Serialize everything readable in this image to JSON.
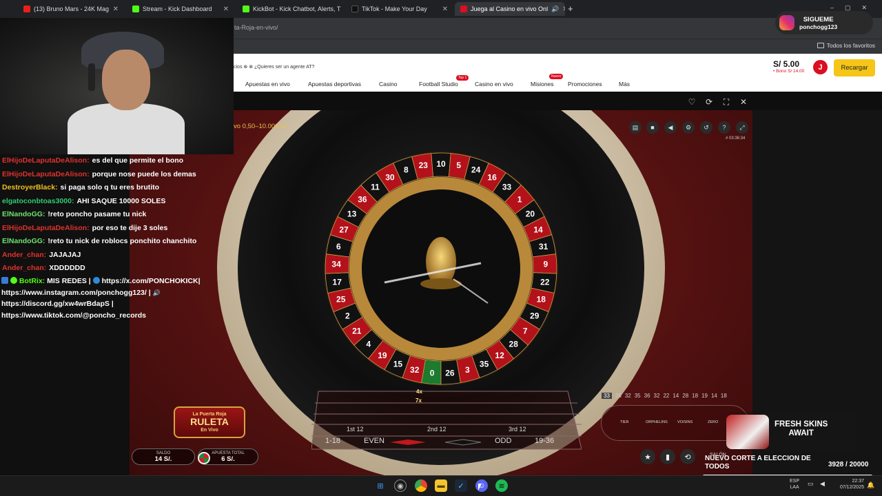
{
  "tabs": [
    {
      "title": "(13) Bruno Mars - 24K Mag",
      "favicon_color": "#e62117"
    },
    {
      "title": "Stream - Kick Dashboard",
      "favicon_color": "#53fc18"
    },
    {
      "title": "KickBot - Kick Chatbot, Alerts, T",
      "favicon_color": "#53fc18"
    },
    {
      "title": "TikTok - Make Your Day",
      "favicon_color": "#111111"
    },
    {
      "title": "Juega al Casino en vivo Onl",
      "favicon_color": "#d90f22"
    }
  ],
  "browser": {
    "url": "ta-Roja-en-vivo/",
    "bookmarks_label": "Todos los favoritos"
  },
  "site": {
    "notice": "cios ⊗ ⊗ ¿Quieres ser un agente AT?",
    "nav": [
      "Apuestas en vivo",
      "Apuestas deportivas",
      "Casino",
      "Football Studio",
      "Casino en vivo",
      "Misiones",
      "Promociones",
      "Más"
    ],
    "badge_top": "Top 1",
    "badge_new": "Nuevo",
    "balance": "S/ 5.00",
    "bonus": "• Bono S/ 14.00",
    "avatar_letter": "J",
    "recharge_label": "Recargar"
  },
  "game": {
    "limits": "vo 0,50–10.000 S/",
    "game_id": "# 03:36:34",
    "logo_line1": "La Puerta Roja",
    "logo_line2": "RULETA",
    "logo_line3": "En Vivo",
    "balance_label": "SALDO",
    "balance_value": "14 S/.",
    "stake_label": "APUESTA TOTAL",
    "stake_value": "6 S/.",
    "history": [
      "33",
      "26",
      "32",
      "35",
      "36",
      "32",
      "22",
      "14",
      "28",
      "18",
      "19",
      "14",
      "18"
    ],
    "racetrack_labels": [
      "TIER",
      "ORPHELINS",
      "VOISINS",
      "ZERO"
    ],
    "outside_bets": [
      "1-18",
      "EVEN",
      "ODD",
      "19-36"
    ],
    "dozens": [
      "1st 12",
      "2nd 12",
      "3rd 12"
    ],
    "multipliers": [
      "4x",
      "7x"
    ],
    "salon_label": "SALÓN",
    "wheel_numbers": [
      "0",
      "32",
      "15",
      "19",
      "4",
      "21",
      "2",
      "25",
      "17",
      "34",
      "6",
      "27",
      "13",
      "36",
      "11",
      "30",
      "8",
      "23",
      "10",
      "5",
      "24",
      "16",
      "33",
      "1",
      "20",
      "14",
      "31",
      "9",
      "22",
      "18",
      "29",
      "7",
      "28",
      "12",
      "35",
      "3",
      "26"
    ]
  },
  "chat": [
    {
      "user": "ElHijoDeLaputaDeAlison:",
      "color": "#e0322d",
      "text": "es del que permite el bono"
    },
    {
      "user": "ElHijoDeLaputaDeAlison:",
      "color": "#e0322d",
      "text": "porque nose puede los demas"
    },
    {
      "user": "DestroyerBlack:",
      "color": "#f0c020",
      "text": "si paga solo q tu eres brutito"
    },
    {
      "user": "elgatoconbtoas3000:",
      "color": "#2ecc71",
      "text": "AHI SAQUE 10000 SOLES"
    },
    {
      "user": "ElNandoGG:",
      "color": "#6fe36f",
      "text": "!reto poncho pasame tu nick"
    },
    {
      "user": "ElHijoDeLaputaDeAlison:",
      "color": "#e0322d",
      "text": "por eso te dije 3 soles"
    },
    {
      "user": "ElNandoGG:",
      "color": "#6fe36f",
      "text": "!reto tu nick de roblocs ponchito chanchito"
    },
    {
      "user": "Ander_chan:",
      "color": "#e0322d",
      "text": "JAJAJAJ"
    },
    {
      "user": "Ander_chan:",
      "color": "#e0322d",
      "text": "XDDDDDD"
    }
  ],
  "bot": {
    "user": "BotRix:",
    "color": "#53fc18",
    "text1": "MIS REDES |",
    "text2": "https://x.com/PONCHOKICK|",
    "text3": "https://www.instagram.com/ponchogg123/ |",
    "text4": "https://discord.gg/xw4wrBdapS |",
    "text5": "https://www.tiktok.com/@poncho_records"
  },
  "overlays": {
    "follow_title": "SIGUEME",
    "follow_handle": "ponchogg123",
    "skins_line1": "FRESH SKINS",
    "skins_line2": "AWAIT",
    "poll_text": "NUEVO CORTE A ELECCION DE TODOS",
    "poll_count": "3928",
    "poll_total": "/ 20000",
    "poll_progress": 0.196
  },
  "taskbar": {
    "lang1": "ESP",
    "lang2": "LAA",
    "time": "22:37",
    "date": "07/12/2025"
  },
  "colors": {
    "brand_red": "#d90f22",
    "recharge_yellow": "#f5c518",
    "kick_green": "#53fc18"
  }
}
